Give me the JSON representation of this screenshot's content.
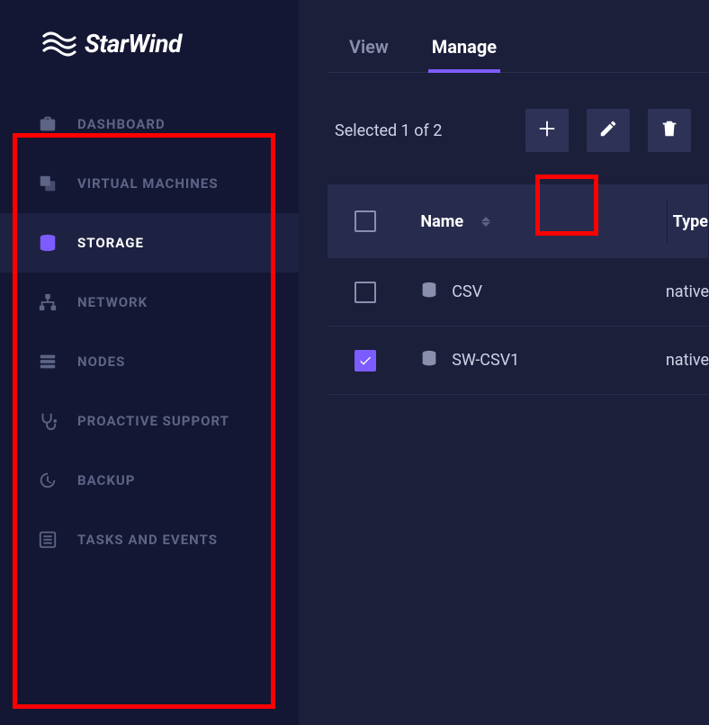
{
  "brand": {
    "name": "StarWind"
  },
  "sidebar": {
    "items": [
      {
        "icon": "briefcase",
        "label": "DASHBOARD",
        "active": false
      },
      {
        "icon": "vm",
        "label": "VIRTUAL MACHINES",
        "active": false
      },
      {
        "icon": "storage",
        "label": "STORAGE",
        "active": true
      },
      {
        "icon": "network",
        "label": "NETWORK",
        "active": false
      },
      {
        "icon": "nodes",
        "label": "NODES",
        "active": false
      },
      {
        "icon": "support",
        "label": "PROACTIVE SUPPORT",
        "active": false
      },
      {
        "icon": "backup",
        "label": "BACKUP",
        "active": false
      },
      {
        "icon": "tasks",
        "label": "TASKS AND EVENTS",
        "active": false
      }
    ]
  },
  "tabs": [
    {
      "label": "View",
      "active": false
    },
    {
      "label": "Manage",
      "active": true
    }
  ],
  "toolbar": {
    "selection_text": "Selected 1 of 2",
    "buttons": {
      "add": "add",
      "edit": "edit",
      "delete": "delete"
    }
  },
  "table": {
    "columns": [
      {
        "key": "name",
        "label": "Name",
        "sortable": true
      },
      {
        "key": "type",
        "label": "Type",
        "sortable": false
      }
    ],
    "rows": [
      {
        "checked": false,
        "name": "CSV",
        "type": "native"
      },
      {
        "checked": true,
        "name": "SW-CSV1",
        "type": "native"
      }
    ]
  }
}
